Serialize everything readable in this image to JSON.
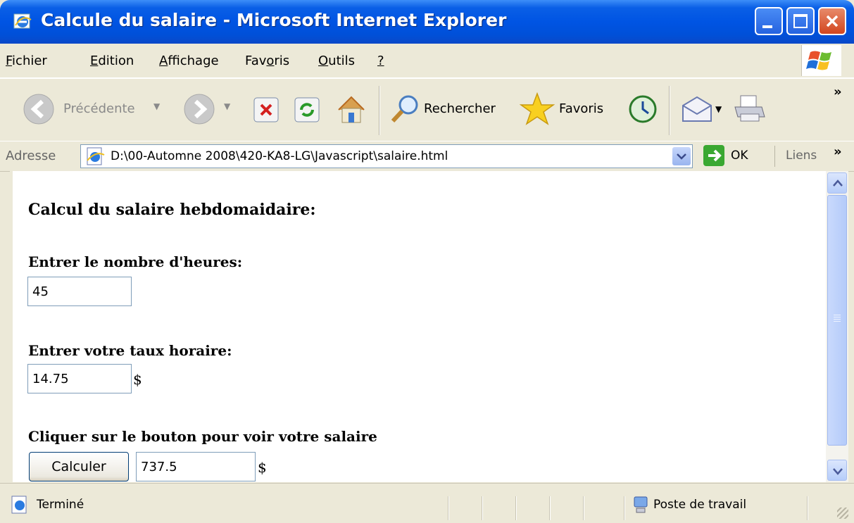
{
  "window": {
    "title": "Calcule du salaire - Microsoft Internet Explorer"
  },
  "menu": {
    "items": [
      "Fichier",
      "Edition",
      "Affichage",
      "Favoris",
      "Outils",
      "?"
    ]
  },
  "toolbar": {
    "back_label": "Précédente",
    "search_label": "Rechercher",
    "favorites_label": "Favoris",
    "overflow": "»"
  },
  "address": {
    "label": "Adresse",
    "url": "D:\\00-Automne 2008\\420-KA8-LG\\Javascript\\salaire.html",
    "go_label": "OK",
    "links_label": "Liens",
    "overflow": "»"
  },
  "page": {
    "heading": "Calcul du salaire hebdomaidaire:",
    "hours_label": "Entrer le nombre d'heures:",
    "hours_value": "45",
    "rate_label": "Entrer votre taux horaire:",
    "rate_value": "14.75",
    "currency": "$",
    "instruction": "Cliquer sur le bouton pour voir votre salaire",
    "button_label": "Calculer",
    "result_value": "737.5"
  },
  "status": {
    "text": "Terminé",
    "zone": "Poste de travail"
  },
  "colors": {
    "titlebar": "#0054e3",
    "close_button": "#d2461f",
    "chrome": "#ece9d8"
  }
}
